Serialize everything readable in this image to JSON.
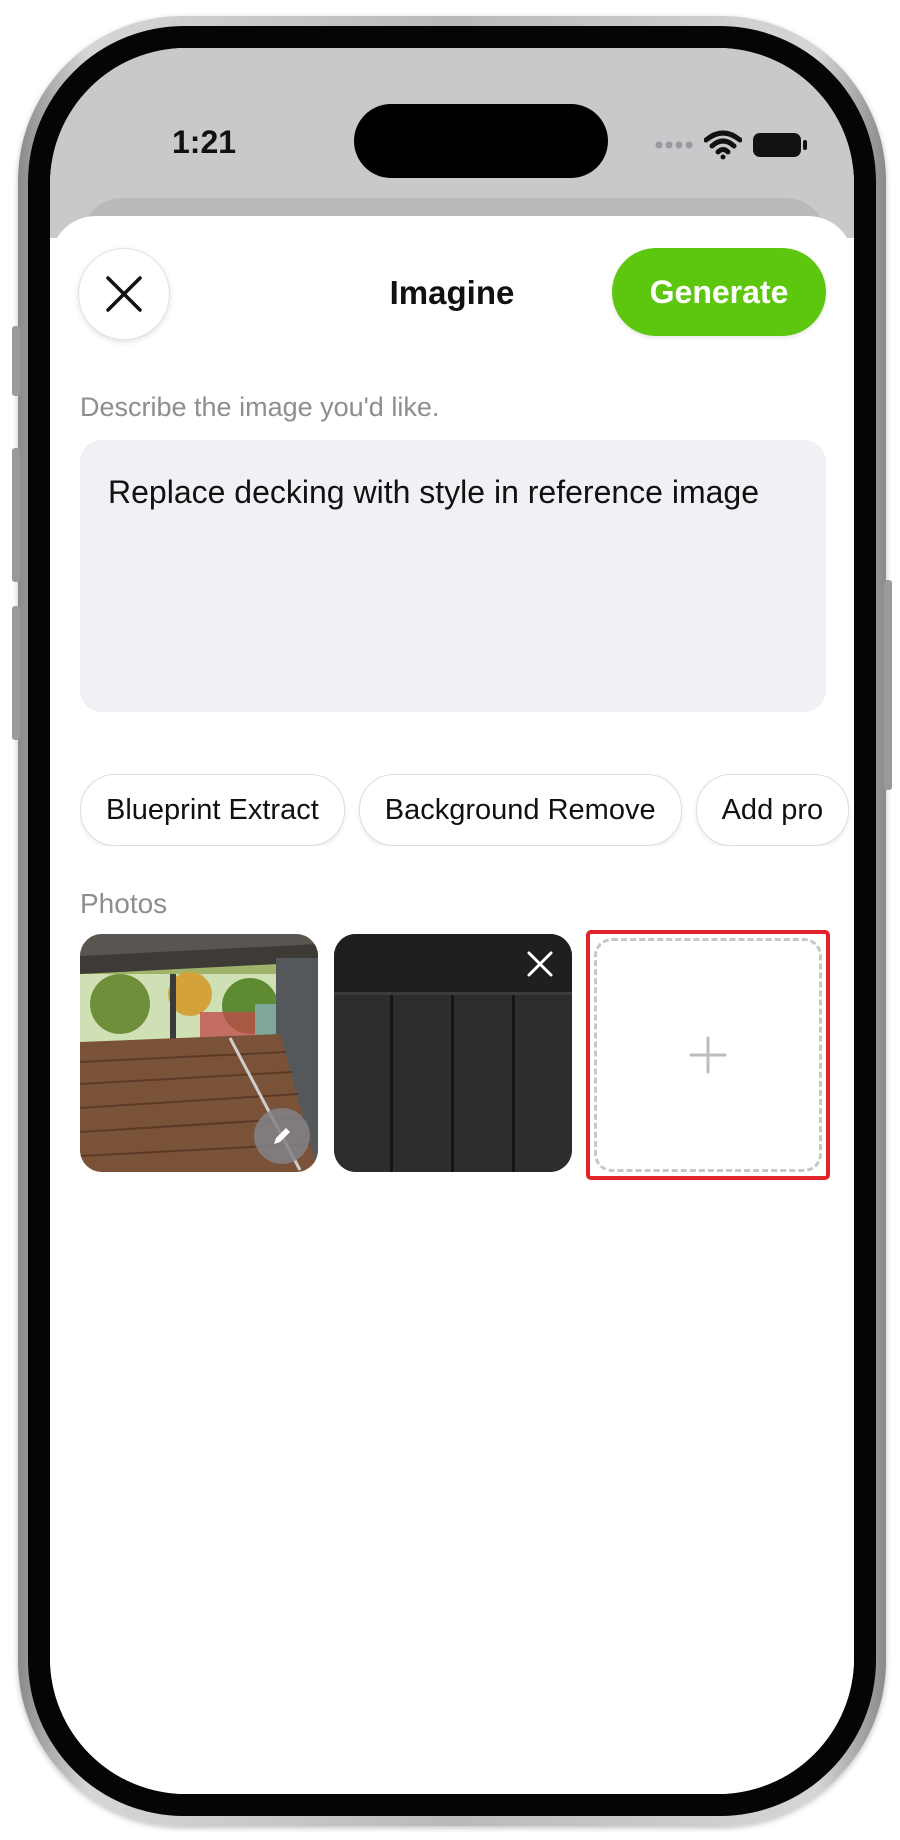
{
  "status_bar": {
    "time": "1:21"
  },
  "sheet": {
    "title": "Imagine",
    "generate_label": "Generate",
    "prompt_label": "Describe the image you'd like.",
    "prompt_value": "Replace decking with style in reference image"
  },
  "chips": [
    "Blueprint Extract",
    "Background Remove",
    "Add pro"
  ],
  "photos": {
    "label": "Photos",
    "items": [
      {
        "name": "deck-photo",
        "edit_icon": "pencil-icon"
      },
      {
        "name": "reference-photo",
        "remove_icon": "close-icon"
      }
    ],
    "add_icon": "plus-icon"
  },
  "colors": {
    "accent_green": "#5cc70e",
    "highlight_red": "#e0242a",
    "label_gray": "#8d8d92",
    "input_bg": "#f1f1f5"
  }
}
